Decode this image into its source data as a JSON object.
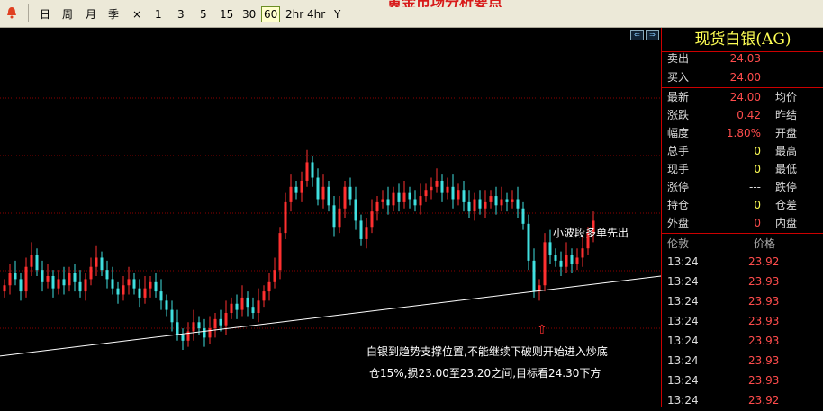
{
  "banner": "黄金市场分析要点",
  "toolbar": {
    "periods": [
      "日",
      "周",
      "月",
      "季"
    ],
    "close": "×",
    "intervals": [
      "1",
      "3",
      "5",
      "15",
      "30",
      "60",
      "2hr",
      "4hr",
      "Y"
    ],
    "active_interval": "60"
  },
  "chart": {
    "annotation_top": "小波段多单先出",
    "arrow": "⇧",
    "annotation_line1": "白银到趋势支撑位置,不能继续下破则开始进入炒底",
    "annotation_line2": "仓15%,损23.00至23.20之间,目标看24.30下方",
    "colors": {
      "up": "#ff3030",
      "down": "#40e0e0",
      "grid": "#8b0000",
      "trend": "#ffffff"
    },
    "closes": [
      23.78,
      23.82,
      23.8,
      23.76,
      23.84,
      23.88,
      23.83,
      23.79,
      23.81,
      23.77,
      23.8,
      23.78,
      23.82,
      23.79,
      23.76,
      23.8,
      23.84,
      23.87,
      23.83,
      23.8,
      23.77,
      23.75,
      23.78,
      23.8,
      23.77,
      23.74,
      23.77,
      23.79,
      23.76,
      23.73,
      23.7,
      23.66,
      23.62,
      23.6,
      23.63,
      23.66,
      23.64,
      23.61,
      23.64,
      23.67,
      23.65,
      23.69,
      23.72,
      23.7,
      23.74,
      23.71,
      23.69,
      23.73,
      23.76,
      23.79,
      23.83,
      23.95,
      24.05,
      24.1,
      24.08,
      24.12,
      24.18,
      24.13,
      24.06,
      24.1,
      24.04,
      23.97,
      24.03,
      24.1,
      24.06,
      23.99,
      23.93,
      23.97,
      24.02,
      24.05,
      24.06,
      24.04,
      24.08,
      24.05,
      24.08,
      24.06,
      24.04,
      24.07,
      24.09,
      24.1,
      24.12,
      24.08,
      24.1,
      24.06,
      24.09,
      24.05,
      24.02,
      24.06,
      24.03,
      24.05,
      24.07,
      24.04,
      24.06,
      24.05,
      24.06,
      24.03,
      23.98,
      23.86,
      23.76,
      23.78,
      23.92,
      23.88,
      23.86,
      23.84,
      23.88,
      23.85,
      23.87,
      23.9,
      23.95,
      23.99
    ],
    "trend_start": 23.55,
    "trend_end": 23.81,
    "ylim": [
      23.5,
      24.5
    ]
  },
  "quote": {
    "title": "现货白银(AG)",
    "sell_label": "卖出",
    "sell": "24.03",
    "buy_label": "买入",
    "buy": "24.00",
    "rows": [
      {
        "l": "最新",
        "v": "24.00",
        "c": "red",
        "r": "均价"
      },
      {
        "l": "涨跌",
        "v": "0.42",
        "c": "red",
        "r": "昨结"
      },
      {
        "l": "幅度",
        "v": "1.80%",
        "c": "red",
        "r": "开盘"
      },
      {
        "l": "总手",
        "v": "0",
        "c": "yellow",
        "r": "最高"
      },
      {
        "l": "现手",
        "v": "0",
        "c": "yellow",
        "r": "最低"
      },
      {
        "l": "涨停",
        "v": "---",
        "c": "white",
        "r": "跌停"
      },
      {
        "l": "持仓",
        "v": "0",
        "c": "yellow",
        "r": "仓差"
      },
      {
        "l": "外盘",
        "v": "0",
        "c": "red",
        "r": "内盘"
      }
    ],
    "col_volume": "伦敦",
    "col_price": "价格",
    "ticks": [
      {
        "t": "13:24",
        "p": "23.92"
      },
      {
        "t": "13:24",
        "p": "23.93"
      },
      {
        "t": "13:24",
        "p": "23.93"
      },
      {
        "t": "13:24",
        "p": "23.93"
      },
      {
        "t": "13:24",
        "p": "23.93"
      },
      {
        "t": "13:24",
        "p": "23.93"
      },
      {
        "t": "13:24",
        "p": "23.93"
      },
      {
        "t": "13:24",
        "p": "23.92"
      }
    ]
  }
}
